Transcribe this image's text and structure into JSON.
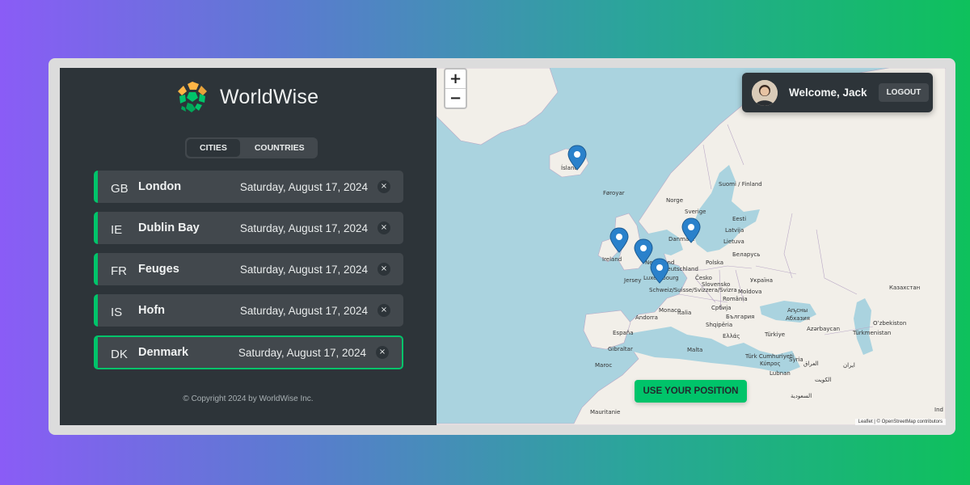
{
  "app": {
    "name": "WorldWise",
    "brand_color": "#00c46a"
  },
  "tabs": [
    {
      "label": "CITIES",
      "active": true
    },
    {
      "label": "COUNTRIES",
      "active": false
    }
  ],
  "cities": [
    {
      "code": "GB",
      "name": "London",
      "date": "Saturday, August 17, 2024",
      "active": false
    },
    {
      "code": "IE",
      "name": "Dublin Bay",
      "date": "Saturday, August 17, 2024",
      "active": false
    },
    {
      "code": "FR",
      "name": "Feuges",
      "date": "Saturday, August 17, 2024",
      "active": false
    },
    {
      "code": "IS",
      "name": "Hofn",
      "date": "Saturday, August 17, 2024",
      "active": false
    },
    {
      "code": "DK",
      "name": "Denmark",
      "date": "Saturday, August 17, 2024",
      "active": true
    }
  ],
  "delete_glyph": "×",
  "footer": "© Copyright 2024 by WorldWise Inc.",
  "map": {
    "zoom_in": "+",
    "zoom_out": "−",
    "use_position_label": "USE YOUR POSITION",
    "attribution": "Leaflet | © OpenStreetMap contributors",
    "labels": [
      "Ísland",
      "Føroyar",
      "Norge",
      "Sverige",
      "Suomi / Finland",
      "Eesti",
      "Latvija",
      "Lietuva",
      "Danmark",
      "Ireland",
      "Nederland",
      "Deutschland",
      "Polska",
      "Беларусь",
      "Україна",
      "Česko",
      "Slovensko",
      "Moldova",
      "România",
      "Schweiz/Suisse/Svizzera/Svizra",
      "Jersey",
      "Luxembourg",
      "Monaco",
      "Andorra",
      "España",
      "Italia",
      "Србија",
      "България",
      "Shqipëria",
      "Ελλάς",
      "Türkiye",
      "Malta",
      "Gibraltar",
      "Maroc",
      "Türk Cumhuriyeti",
      "Κύπρος",
      "Lubnan",
      "Syria",
      "العراق",
      "ایران",
      "Azərbaycan",
      "Türkmenistan",
      "Oʻzbekiston",
      "Казахстан",
      "Аҧсны",
      "Абхазия",
      "الكويت",
      "السعودية",
      "Mauritanie",
      "Ind"
    ]
  },
  "user": {
    "welcome": "Welcome, Jack",
    "logout_label": "LOGOUT"
  }
}
